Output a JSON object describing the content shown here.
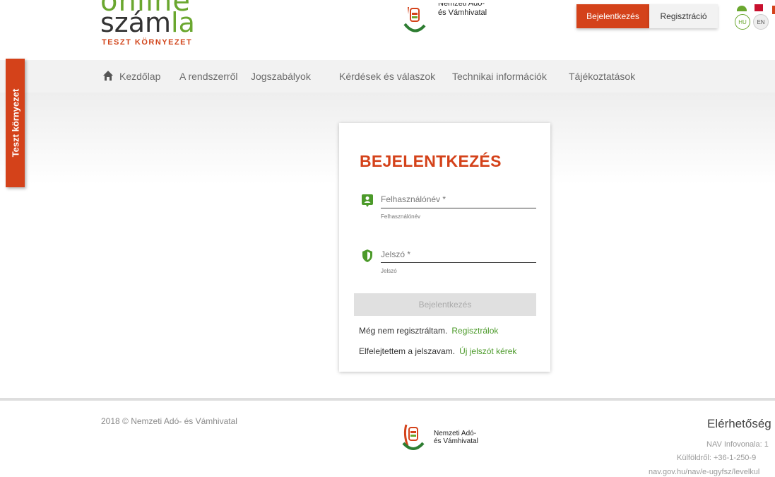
{
  "header": {
    "logo_top": "online",
    "logo_main_a": "szám",
    "logo_main_b": "la",
    "logo_sub": "TESZT KÖRNYEZET",
    "agency_line1": "Nemzeti Adó-",
    "agency_line2": "és Vámhivatal",
    "login_button": "Bejelentkezés",
    "register_button": "Regisztráció",
    "lang_hu": "HU",
    "lang_en": "EN"
  },
  "nav": {
    "items": [
      "Kezdőlap",
      "A rendszerről",
      "Jogszabályok",
      "Kérdések és válaszok",
      "Technikai információk",
      "Tájékoztatások"
    ]
  },
  "side_tab": "Teszt környezet",
  "login_card": {
    "title": "BEJELENTKEZÉS",
    "username_label": "Felhasználónév *",
    "username_hint": "Felhasználónév",
    "password_label": "Jelszó *",
    "password_hint": "Jelszó",
    "submit": "Bejelentkezés",
    "no_account_text": "Még nem regisztráltam.",
    "register_link": "Regisztrálok",
    "forgot_text": "Elfelejtettem a jelszavam.",
    "forgot_link": "Új jelszót kérek"
  },
  "footer": {
    "copyright": "2018 © Nemzeti Adó- és Vámhivatal",
    "agency_line1": "Nemzeti Adó-",
    "agency_line2": "és Vámhivatal",
    "contact_title": "Elérhetőség",
    "contact_line1": "NAV Infovonala: 1",
    "contact_line2": "Külföldről: +36-1-250-9",
    "contact_line3": "nav.gov.hu/nav/e-ugyfsz/levelkul"
  },
  "colors": {
    "brand_red": "#d4421a",
    "brand_green": "#6aa72f"
  }
}
